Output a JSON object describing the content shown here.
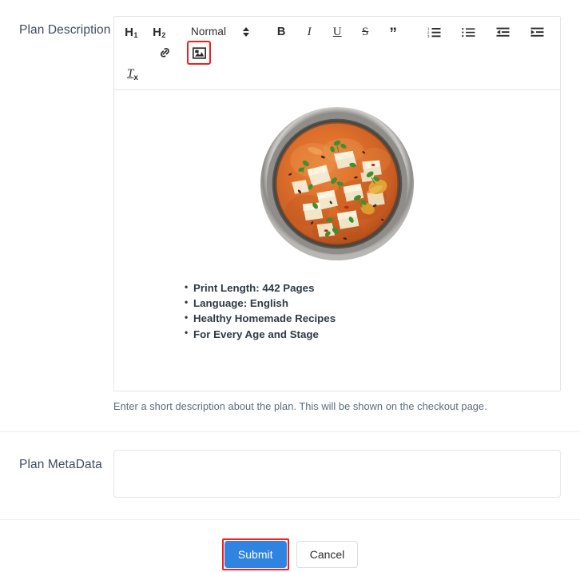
{
  "form": {
    "description_field": {
      "label": "Plan Description",
      "help_text": "Enter a short description about the plan. This will be shown on the checkout page."
    },
    "metadata_field": {
      "label": "Plan MetaData",
      "value": "",
      "placeholder": ""
    }
  },
  "editor": {
    "toolbar": {
      "heading1": "H",
      "heading1_sub": "1",
      "heading2": "H",
      "heading2_sub": "2",
      "format_picker_value": "Normal",
      "bold": "B",
      "italic": "I",
      "underline": "U",
      "strikethrough": "S",
      "blockquote": "”",
      "clear_format": "T",
      "clear_format_sub": "x",
      "ordered_list_name": "ordered-list",
      "bullet_list_name": "bullet-list",
      "outdent_name": "outdent",
      "indent_name": "indent",
      "link_name": "link",
      "image_name": "image",
      "active_button": "image"
    },
    "content": {
      "image_alt": "Bowl of paneer curry garnished with coriander",
      "bullets": [
        "Print Length: 442 Pages",
        "Language: English",
        "Healthy Homemade Recipes",
        "For Every Age and Stage"
      ]
    }
  },
  "actions": {
    "submit_label": "Submit",
    "cancel_label": "Cancel"
  },
  "colors": {
    "submit_blue": "#2f84e0",
    "highlight_red": "#ef2020",
    "label_text": "#3f4c5e",
    "help_text": "#5d6b7c",
    "border": "#e2e4e6"
  }
}
